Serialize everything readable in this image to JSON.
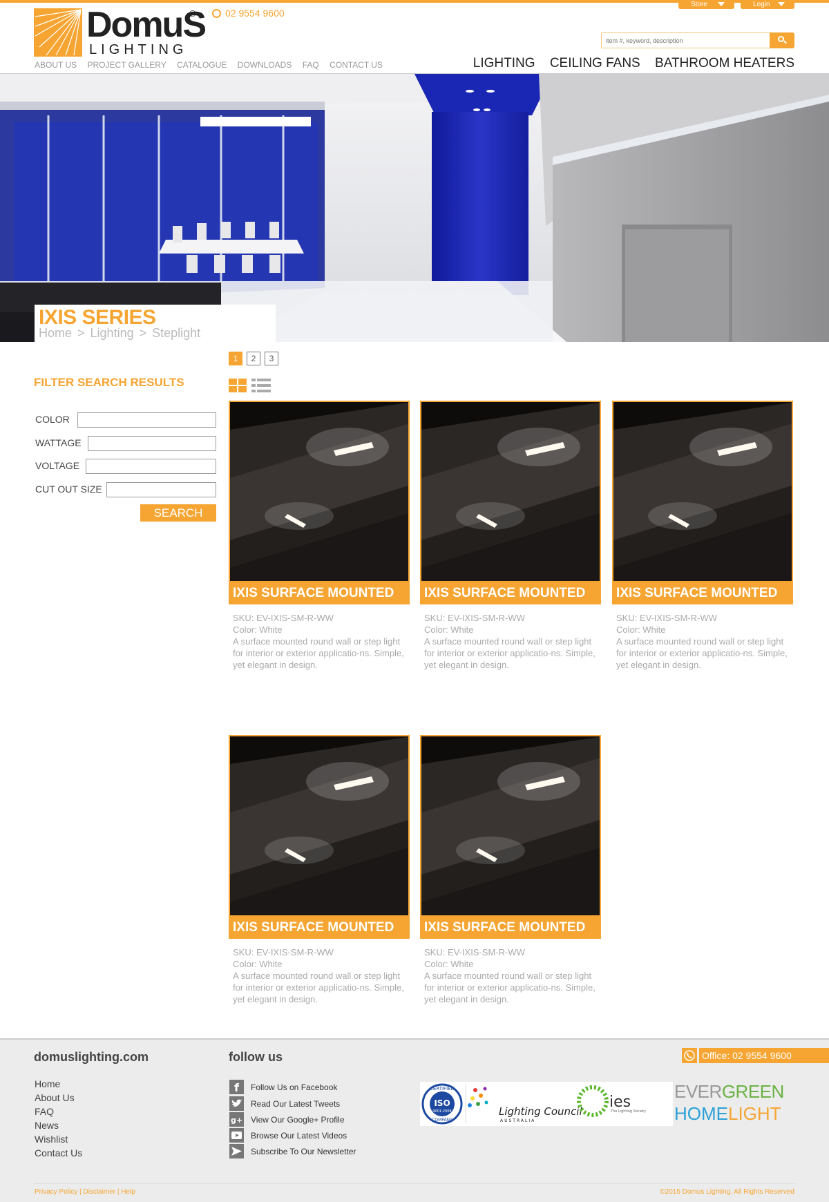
{
  "header": {
    "store_label": "Store",
    "login_label": "Login",
    "logo_word": "DomuS",
    "logo_reg": "®",
    "logo_sub": "LIGHTING",
    "phone": "02 9554 9600",
    "search_placeholder": "item #, keyword, description",
    "subnav": [
      "ABOUT US",
      "PROJECT GALLERY",
      "CATALOGUE",
      "DOWNLOADS",
      "FAQ",
      "CONTACT US"
    ],
    "mainnav": [
      "LIGHTING",
      "CEILING FANS",
      "BATHROOM HEATERS"
    ]
  },
  "hero": {
    "title": "IXIS SERIES",
    "breadcrumb": [
      "Home",
      "Lighting",
      "Steplight"
    ],
    "separator": ">"
  },
  "pager": [
    "1",
    "2",
    "3"
  ],
  "filter": {
    "title": "FILTER SEARCH RESULTS",
    "fields": [
      "COLOR",
      "WATTAGE",
      "VOLTAGE",
      "CUT OUT SIZE"
    ],
    "button": "SEARCH"
  },
  "products": [
    {
      "name": "IXIS SURFACE MOUNTED",
      "sku": "SKU: EV-IXIS-SM-R-WW",
      "color": "Color: White",
      "desc": "A surface mounted round wall or step light for interior or exterior applicatio-ns. Simple, yet elegant in design."
    },
    {
      "name": "IXIS SURFACE MOUNTED",
      "sku": "SKU: EV-IXIS-SM-R-WW",
      "color": "Color: White",
      "desc": "A surface mounted round wall or step light for interior or exterior applicatio-ns. Simple, yet elegant in design."
    },
    {
      "name": "IXIS SURFACE MOUNTED",
      "sku": "SKU: EV-IXIS-SM-R-WW",
      "color": "Color: White",
      "desc": "A surface mounted round wall or step light for interior or exterior applicatio-ns. Simple, yet elegant in design."
    },
    {
      "name": "IXIS SURFACE MOUNTED",
      "sku": "SKU: EV-IXIS-SM-R-WW",
      "color": "Color: White",
      "desc": "A surface mounted round wall or step light for interior or exterior applicatio-ns. Simple, yet elegant in design."
    },
    {
      "name": "IXIS SURFACE MOUNTED",
      "sku": "SKU: EV-IXIS-SM-R-WW",
      "color": "Color: White",
      "desc": "A surface mounted round wall or step light for interior or exterior applicatio-ns. Simple, yet elegant in design."
    }
  ],
  "footer": {
    "site": "domuslighting.com",
    "links": [
      "Home",
      "About Us",
      "FAQ",
      "News",
      "Wishlist",
      "Contact Us"
    ],
    "follow_title": "follow us",
    "social": [
      {
        "icon": "facebook-icon",
        "label": "Follow Us on Facebook"
      },
      {
        "icon": "twitter-icon",
        "label": "Read Our Latest Tweets"
      },
      {
        "icon": "google-plus-icon",
        "label": "View Our Google+ Profile"
      },
      {
        "icon": "youtube-icon",
        "label": "Browse Our Latest Videos"
      },
      {
        "icon": "newsletter-icon",
        "label": "Subscribe To Our Newsletter"
      }
    ],
    "office": "Office: 02 9554 9600",
    "iso_top": "CERTIFIED",
    "iso_mid": "ISO",
    "iso_num": "9001:2008",
    "iso_bottom": "COMPANY",
    "lighting_council": "Lighting Council",
    "lighting_council_sub": "AUSTRALIA",
    "ies": "ies",
    "ies_sub": "The Lighting Society",
    "evergreen_a": "EVER",
    "evergreen_b": "GREEN",
    "homelight_a": "HOME",
    "homelight_b": "LIGHT",
    "legal": "Privacy Policy | Disclaimer | Help",
    "copyright": "©2015 Domus Lighting. All Rights Reserved"
  },
  "colors": {
    "accent": "#f6a532",
    "hero_blue": "#1e2bb0",
    "footer_bg": "#ececec"
  }
}
